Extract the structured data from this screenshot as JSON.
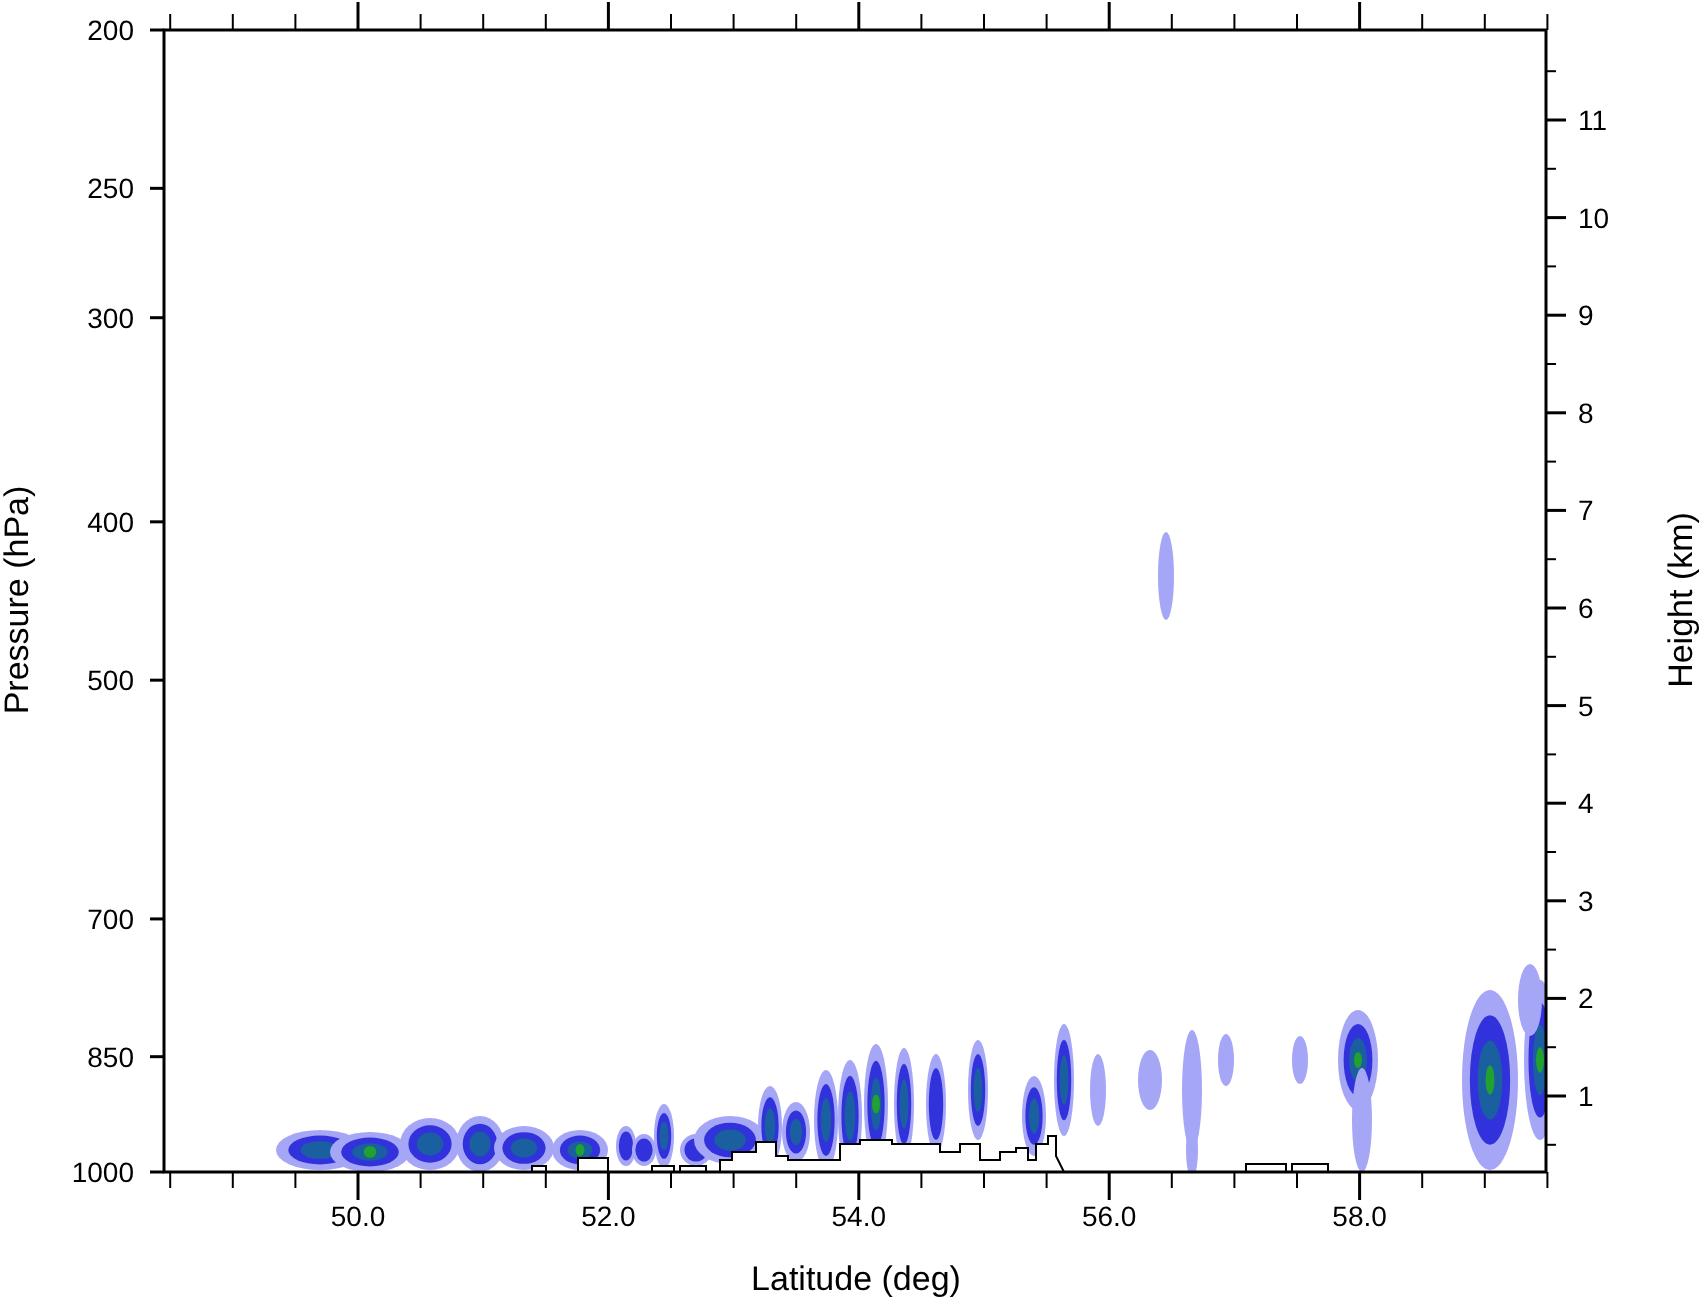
{
  "chart": {
    "left_axis": {
      "title": "Pressure (hPa)",
      "ticks": [
        "200",
        "250",
        "300",
        "400",
        "500",
        "700",
        "850",
        "1000"
      ]
    },
    "right_axis": {
      "title": "Height (km)",
      "ticks": [
        "11",
        "10",
        "9",
        "8",
        "7",
        "6",
        "5",
        "4",
        "3",
        "2",
        "1"
      ]
    },
    "bottom_axis": {
      "title": "Latitude (deg)",
      "ticks": [
        "50.0",
        "52.0",
        "54.0",
        "56.0",
        "58.0"
      ]
    }
  }
}
